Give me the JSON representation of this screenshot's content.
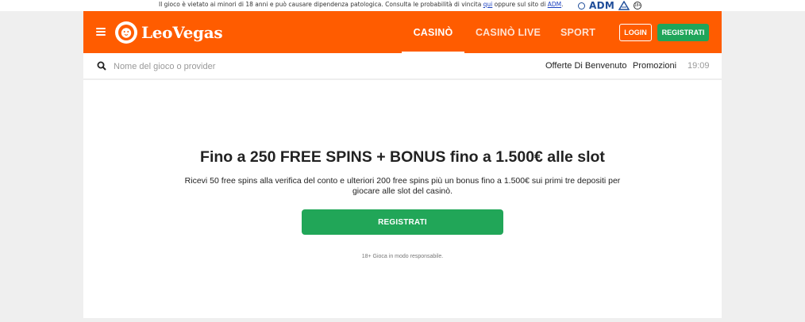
{
  "topbar": {
    "notice_before": "Il gioco è vietato ai minori di 18 anni e può causare dipendenza patologica. Consulta le probabilità di vincita ",
    "notice_link": "qui",
    "notice_middle": " oppure sul sito di ",
    "notice_adm_link": "ADM",
    "notice_after": ".",
    "adm_logo": "ADM",
    "age_badge": "18+"
  },
  "header": {
    "brand": "LeoVegas",
    "nav": [
      {
        "label": "CASINÒ",
        "active": true
      },
      {
        "label": "CASINÒ LIVE",
        "active": false
      },
      {
        "label": "SPORT",
        "active": false
      }
    ],
    "login_label": "LOGIN",
    "register_label": "REGISTRATI",
    "brand_color": "#ff5c00",
    "accent_green": "#21a658"
  },
  "subbar": {
    "search_placeholder": "Nome del gioco o provider",
    "links": [
      "Offerte Di Benvenuto",
      "Promozioni"
    ],
    "time": "19:09"
  },
  "promo": {
    "headline": "Fino a 250 FREE SPINS + BONUS fino a 1.500€ alle slot",
    "description": "Ricevi 50 free spins alla verifica del conto e ulteriori 200 free spins più un bonus fino a 1.500€ sui primi tre depositi per giocare alle slot del casinò.",
    "cta_label": "REGISTRATI",
    "disclaimer": "18+ Gioca in modo responsabile."
  }
}
